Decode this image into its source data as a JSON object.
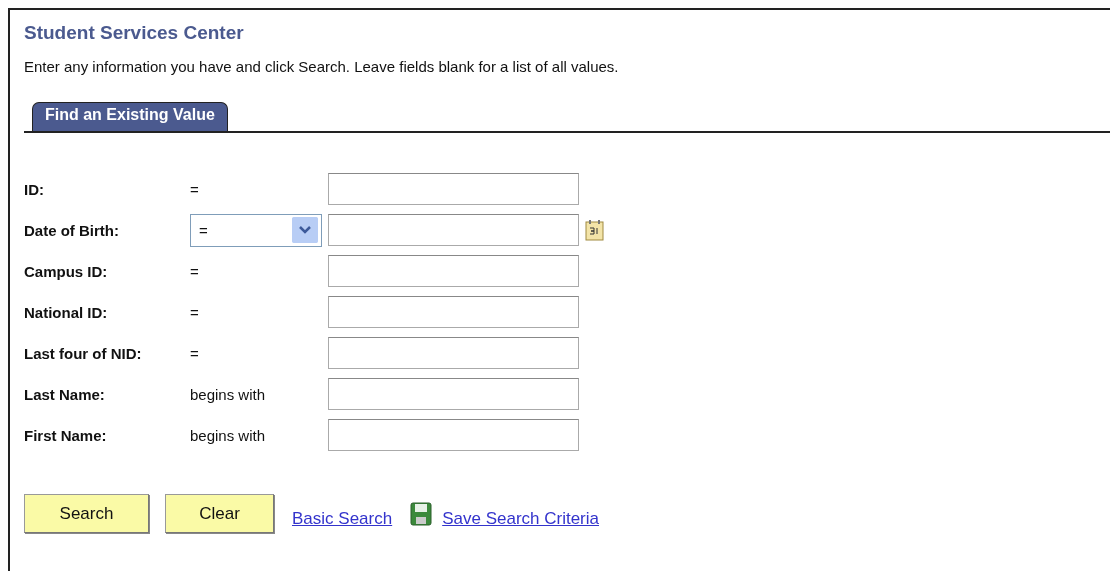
{
  "title": "Student Services Center",
  "instructions": "Enter any information you have and click Search. Leave fields blank for a list of all values.",
  "tabs": [
    {
      "label": "Find an Existing Value",
      "selected": true
    }
  ],
  "fields": [
    {
      "label": "ID:",
      "kind": "fixed",
      "operator": "="
    },
    {
      "label": "Date of Birth:",
      "kind": "select",
      "operator": "=",
      "calendar": true
    },
    {
      "label": "Campus ID:",
      "kind": "fixed",
      "operator": "="
    },
    {
      "label": "National ID:",
      "kind": "fixed",
      "operator": "="
    },
    {
      "label": "Last four of NID:",
      "kind": "fixed",
      "operator": "="
    },
    {
      "label": "Last Name:",
      "kind": "fixed",
      "operator": "begins with"
    },
    {
      "label": "First Name:",
      "kind": "fixed",
      "operator": "begins with"
    }
  ],
  "buttons": [
    "Search",
    "Clear"
  ],
  "links": [
    {
      "label": "Basic Search",
      "kind": "plain"
    },
    {
      "label": "Save Search Criteria",
      "kind": "save"
    }
  ]
}
